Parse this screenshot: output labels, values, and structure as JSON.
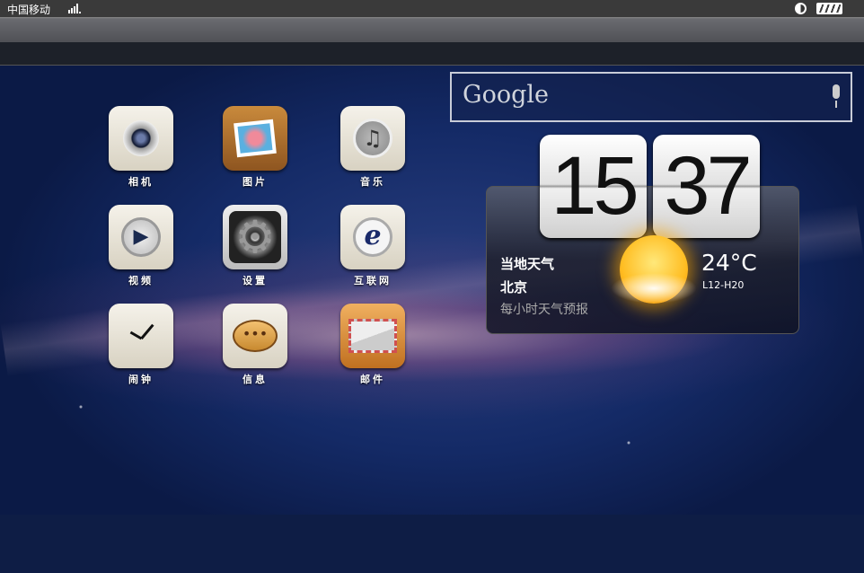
{
  "status": {
    "carrier": "中国移动"
  },
  "apps": [
    {
      "label": "相机",
      "icon": "camera-icon"
    },
    {
      "label": "图片",
      "icon": "photos-icon"
    },
    {
      "label": "音乐",
      "icon": "music-icon"
    },
    {
      "label": "视频",
      "icon": "video-icon"
    },
    {
      "label": "设置",
      "icon": "settings-gear-icon"
    },
    {
      "label": "互联网",
      "icon": "internet-browser-icon"
    },
    {
      "label": "闹钟",
      "icon": "alarm-clock-icon"
    },
    {
      "label": "信息",
      "icon": "message-bubble-icon"
    },
    {
      "label": "邮件",
      "icon": "mail-envelope-icon"
    }
  ],
  "search": {
    "logo": "Google"
  },
  "clock": {
    "hour": "15",
    "minute": "37"
  },
  "weather": {
    "title": "当地天气",
    "city": "北京",
    "subtitle": "每小时天气预报",
    "temp": "24°C",
    "range": "L12-H20"
  }
}
